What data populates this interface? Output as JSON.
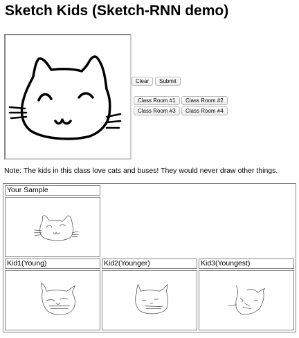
{
  "page": {
    "title": "Sketch Kids (Sketch-RNN demo)"
  },
  "controls": {
    "clear_label": "Clear",
    "submit_label": "Submit",
    "classrooms": [
      "Class Room #1",
      "Class Room #2",
      "Class Room #3",
      "Class Room #4"
    ]
  },
  "note": "Note: The kids in this class love cats and buses! They would never draw other things.",
  "results": {
    "your_sample_label": "Your Sample",
    "kids": [
      "Kid1(Young)",
      "Kid2(Younger)",
      "Kid3(Youngest)"
    ]
  }
}
